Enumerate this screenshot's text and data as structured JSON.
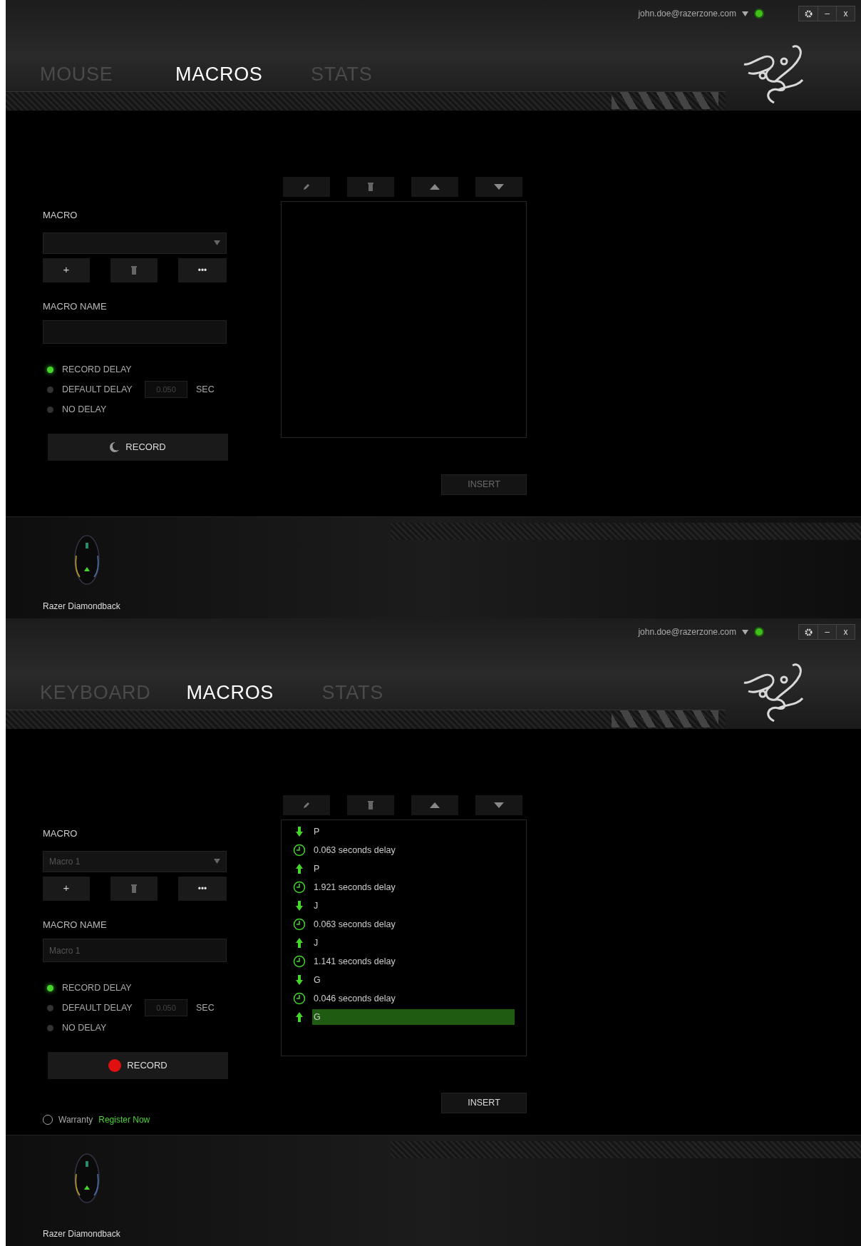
{
  "panels": [
    {
      "account": {
        "email": "john.doe@razerzone.com"
      },
      "window_controls": [
        "–",
        "x"
      ],
      "tabs": [
        {
          "label": "MOUSE",
          "selected": false
        },
        {
          "label": "MACROS",
          "selected": true
        },
        {
          "label": "STATS",
          "selected": false
        }
      ],
      "macro": {
        "label": "MACRO",
        "add": "+",
        "more": "•••"
      },
      "macro_name": {
        "label": "MACRO NAME"
      },
      "delay_options": [
        {
          "label": "RECORD DELAY",
          "selected": true
        },
        {
          "label": "DEFAULT DELAY",
          "selected": false,
          "value": "0.050",
          "unit": "SEC"
        },
        {
          "label": "NO DELAY",
          "selected": false
        }
      ],
      "record": {
        "label": "RECORD",
        "recording": false
      },
      "insert": {
        "label": "INSERT",
        "disabled": true
      },
      "device": {
        "name": "Razer Diamondback"
      }
    },
    {
      "account": {
        "email": "john.doe@razerzone.com"
      },
      "window_controls": [
        "–",
        "x"
      ],
      "tabs": [
        {
          "label": "KEYBOARD",
          "selected": false
        },
        {
          "label": "MACROS",
          "selected": true
        },
        {
          "label": "STATS",
          "selected": false
        }
      ],
      "macro": {
        "label": "MACRO",
        "value": "Macro 1",
        "add": "+",
        "more": "•••"
      },
      "macro_name": {
        "label": "MACRO NAME",
        "value": "Macro 1"
      },
      "delay_options": [
        {
          "label": "RECORD DELAY",
          "selected": true
        },
        {
          "label": "DEFAULT DELAY",
          "selected": false,
          "value": "0.050",
          "unit": "SEC"
        },
        {
          "label": "NO DELAY",
          "selected": false
        }
      ],
      "record": {
        "label": "RECORD",
        "recording": true
      },
      "events": [
        {
          "kind": "down",
          "label": "P",
          "selected": false
        },
        {
          "kind": "delay",
          "label": "0.063 seconds delay",
          "selected": false
        },
        {
          "kind": "up",
          "label": "P",
          "selected": false
        },
        {
          "kind": "delay",
          "label": "1.921 seconds delay",
          "selected": false
        },
        {
          "kind": "down",
          "label": "J",
          "selected": false
        },
        {
          "kind": "delay",
          "label": "0.063 seconds delay",
          "selected": false
        },
        {
          "kind": "up",
          "label": "J",
          "selected": false
        },
        {
          "kind": "delay",
          "label": "1.141 seconds delay",
          "selected": false
        },
        {
          "kind": "down",
          "label": "G",
          "selected": false
        },
        {
          "kind": "delay",
          "label": "0.046 seconds delay",
          "selected": false
        },
        {
          "kind": "up",
          "label": "G",
          "selected": true
        }
      ],
      "insert": {
        "label": "INSERT",
        "disabled": false
      },
      "warranty": {
        "label": "Warranty",
        "link": "Register Now"
      },
      "device": {
        "name": "Razer Diamondback"
      }
    }
  ]
}
